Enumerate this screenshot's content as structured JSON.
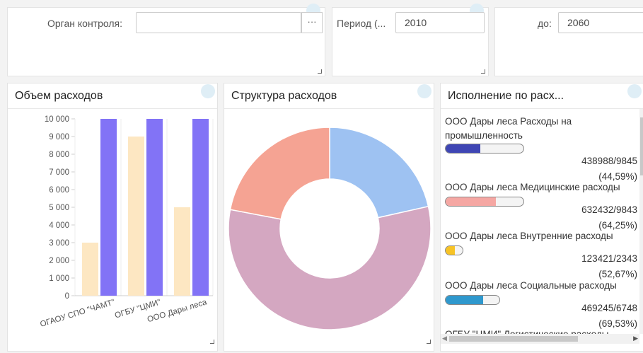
{
  "filters": {
    "organ_label": "Орган контроля:",
    "organ_value": "",
    "dots_label": "···",
    "period_label": "Период (...",
    "period_from": "2010",
    "to_label": "до:",
    "period_to": "2060"
  },
  "panels": {
    "volume_title": "Объем расходов",
    "structure_title": "Структура расходов",
    "execution_title": "Исполнение по расх..."
  },
  "chart_data": [
    {
      "type": "bar",
      "categories": [
        "ОГАОУ СПО \"ЧАМТ\"",
        "ОГБУ \"ЦМИ\"",
        "ООО Дары леса"
      ],
      "series": [
        {
          "values": [
            3000,
            9000,
            5000
          ],
          "color": "#fde7c2"
        },
        {
          "values": [
            10000,
            10000,
            10000
          ],
          "color": "#7b6cf6"
        }
      ],
      "ylim": [
        0,
        10000
      ],
      "yticks": [
        "0",
        "1 000",
        "2 000",
        "3 000",
        "4 000",
        "5 000",
        "6 000",
        "7 000",
        "8 000",
        "9 000",
        "10 000"
      ],
      "grid": true
    },
    {
      "type": "pie",
      "donut": true,
      "slices": [
        {
          "value": 21.5,
          "color": "#9ec2f2"
        },
        {
          "value": 56.5,
          "color": "#d4a7c1"
        },
        {
          "value": 22.0,
          "color": "#f5a393"
        }
      ]
    }
  ],
  "execution": {
    "items": [
      {
        "name": "ООО Дары леса Расходы на промышленность",
        "value": "438988/9845",
        "percent": "(44,59%)",
        "progress": 0.4459,
        "color": "#3f46b4"
      },
      {
        "name": "ООО Дары леса Медицинские расходы",
        "value": "632432/9843",
        "percent": "(64,25%)",
        "progress": 0.6425,
        "color": "#f5a7a3"
      },
      {
        "name": "ООО Дары леса Внутренние расходы",
        "value": "123421/2343",
        "percent": "(52,67%)",
        "progress": 0.5267,
        "color": "#f7c325"
      },
      {
        "name": "ООО Дары леса Социальные расходы",
        "value": "469245/6748",
        "percent": "(69,53%)",
        "progress": 0.6953,
        "color": "#2f98cd"
      },
      {
        "name": "ОГБУ \"ЦМИ\" Логистические расходы"
      }
    ]
  }
}
